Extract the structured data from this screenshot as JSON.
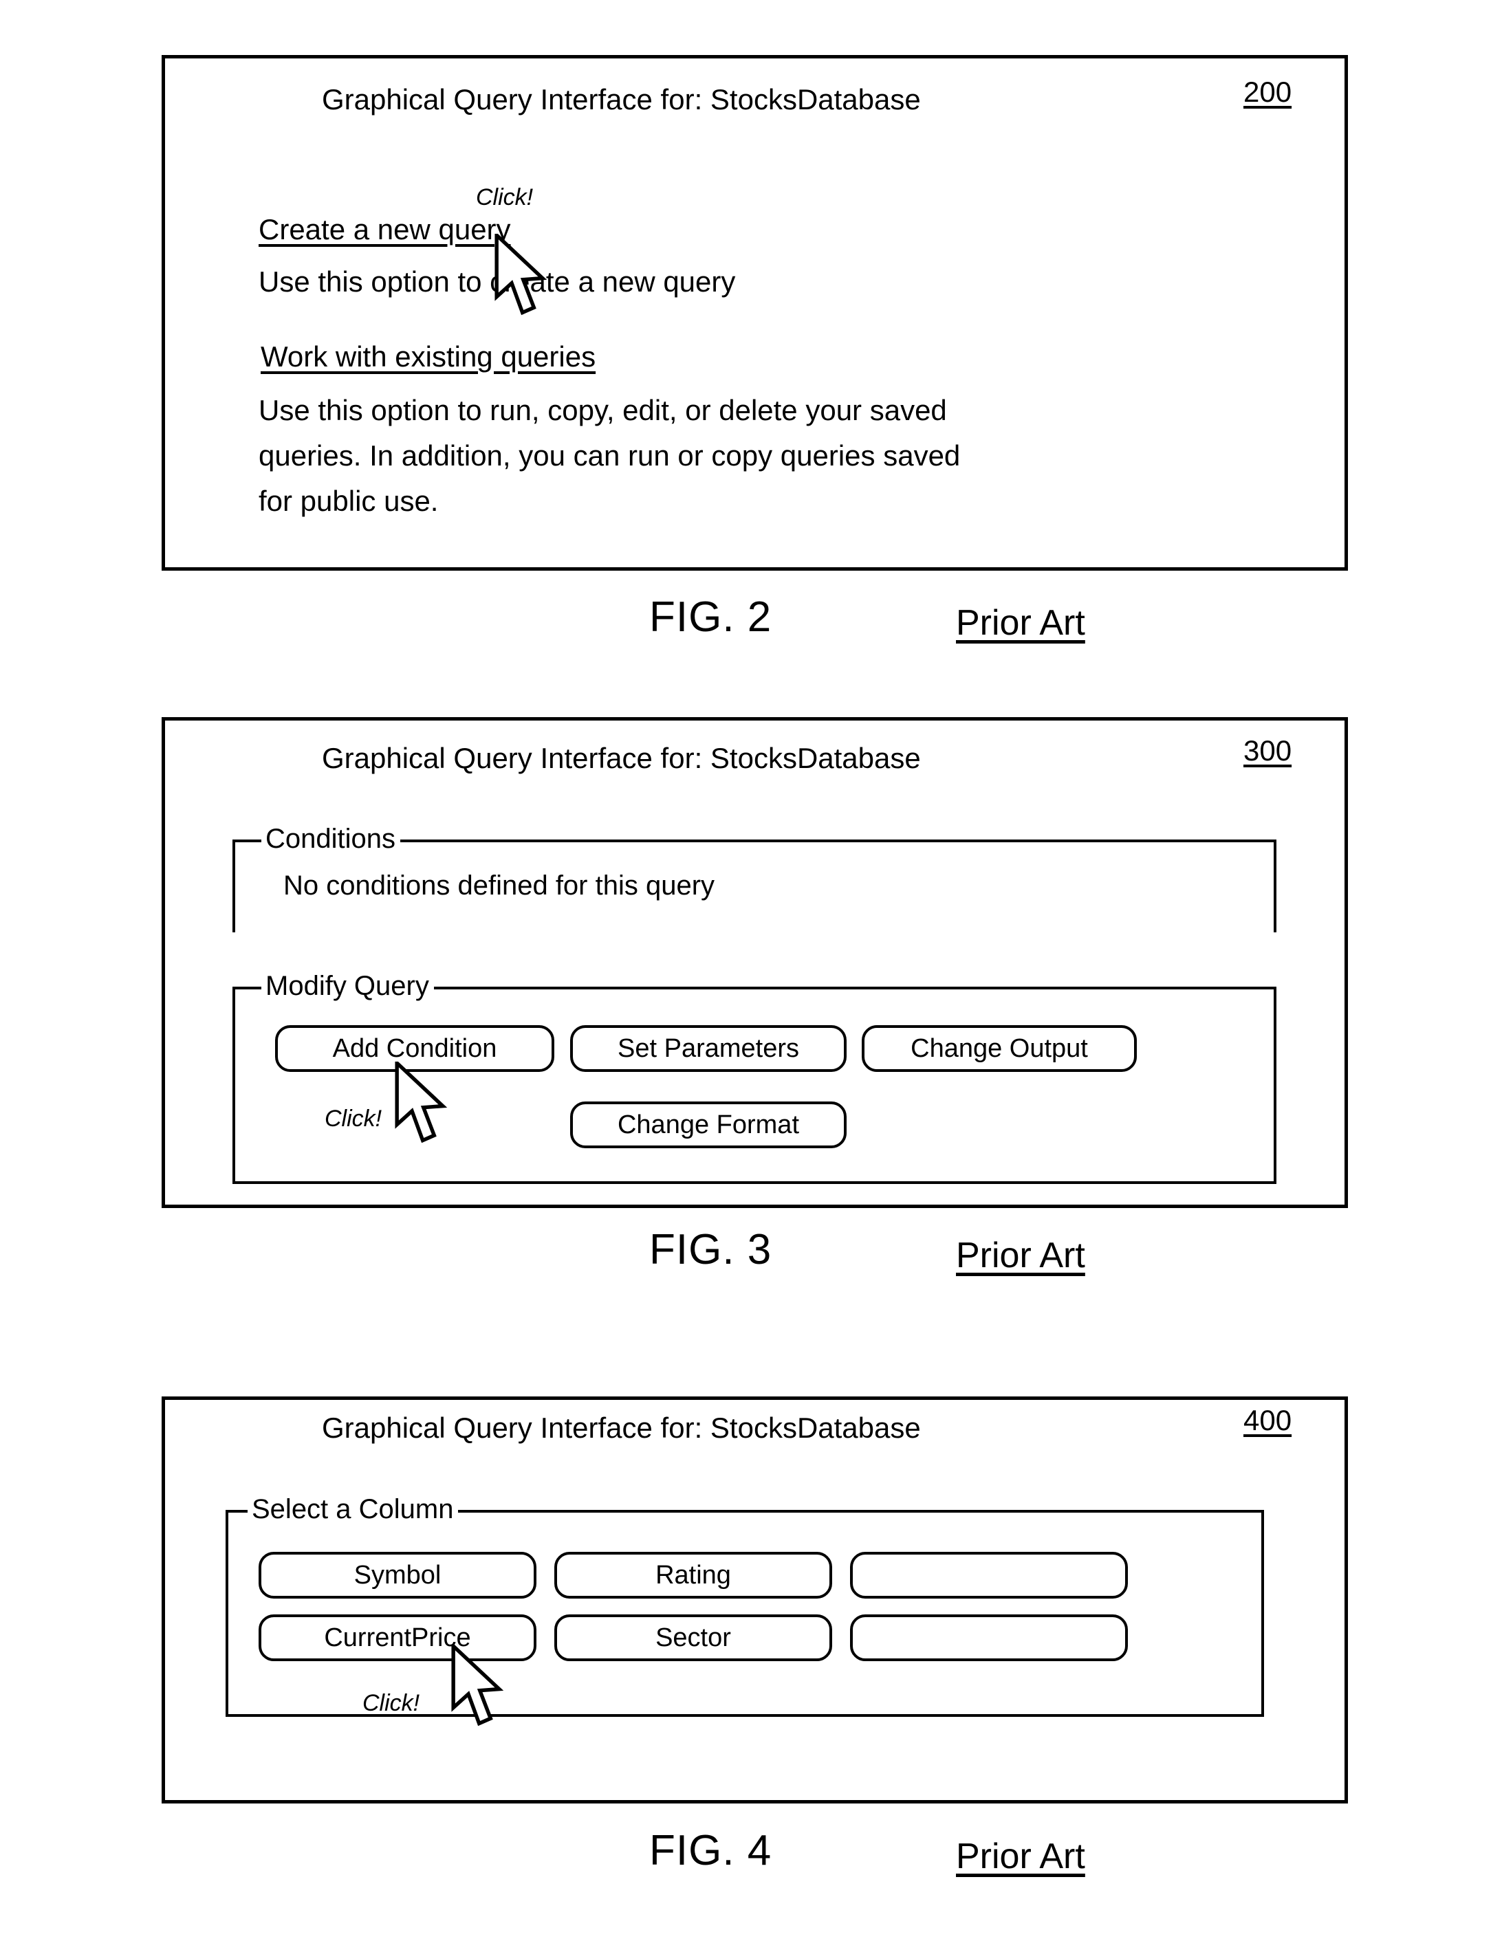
{
  "page": {
    "figures": [
      {
        "id": "fig2",
        "ref_number": "200",
        "caption": "FIG. 2",
        "prior_art": "Prior Art",
        "title": "Graphical Query Interface for:  StocksDatabase",
        "click_label": "Click!",
        "links": [
          {
            "label": "Create a new query",
            "description": "Use this option to create a new query"
          },
          {
            "label": "Work with existing queries",
            "description_lines": [
              "Use this option to run, copy, edit, or delete your saved",
              "queries.  In addition, you can run or copy queries saved",
              "for public use."
            ]
          }
        ]
      },
      {
        "id": "fig3",
        "ref_number": "300",
        "caption": "FIG. 3",
        "prior_art": "Prior Art",
        "title": "Graphical Query Interface for:  StocksDatabase",
        "click_label": "Click!",
        "conditions_group": {
          "legend": "Conditions",
          "message": "No conditions defined for this query"
        },
        "modify_group": {
          "legend": "Modify Query",
          "buttons": [
            "Add Condition",
            "Set Parameters",
            "Change Output",
            "Change Format"
          ]
        }
      },
      {
        "id": "fig4",
        "ref_number": "400",
        "caption": "FIG. 4",
        "prior_art": "Prior Art",
        "title": "Graphical Query Interface for:  StocksDatabase",
        "click_label": "Click!",
        "select_column_group": {
          "legend": "Select a Column",
          "columns": [
            "Symbol",
            "Rating",
            "",
            "CurrentPrice",
            "Sector",
            ""
          ]
        }
      }
    ]
  },
  "icons": {
    "cursor": "mouse-pointer-arrow-icon"
  },
  "colors": {
    "ink": "#000000",
    "paper": "#ffffff"
  }
}
